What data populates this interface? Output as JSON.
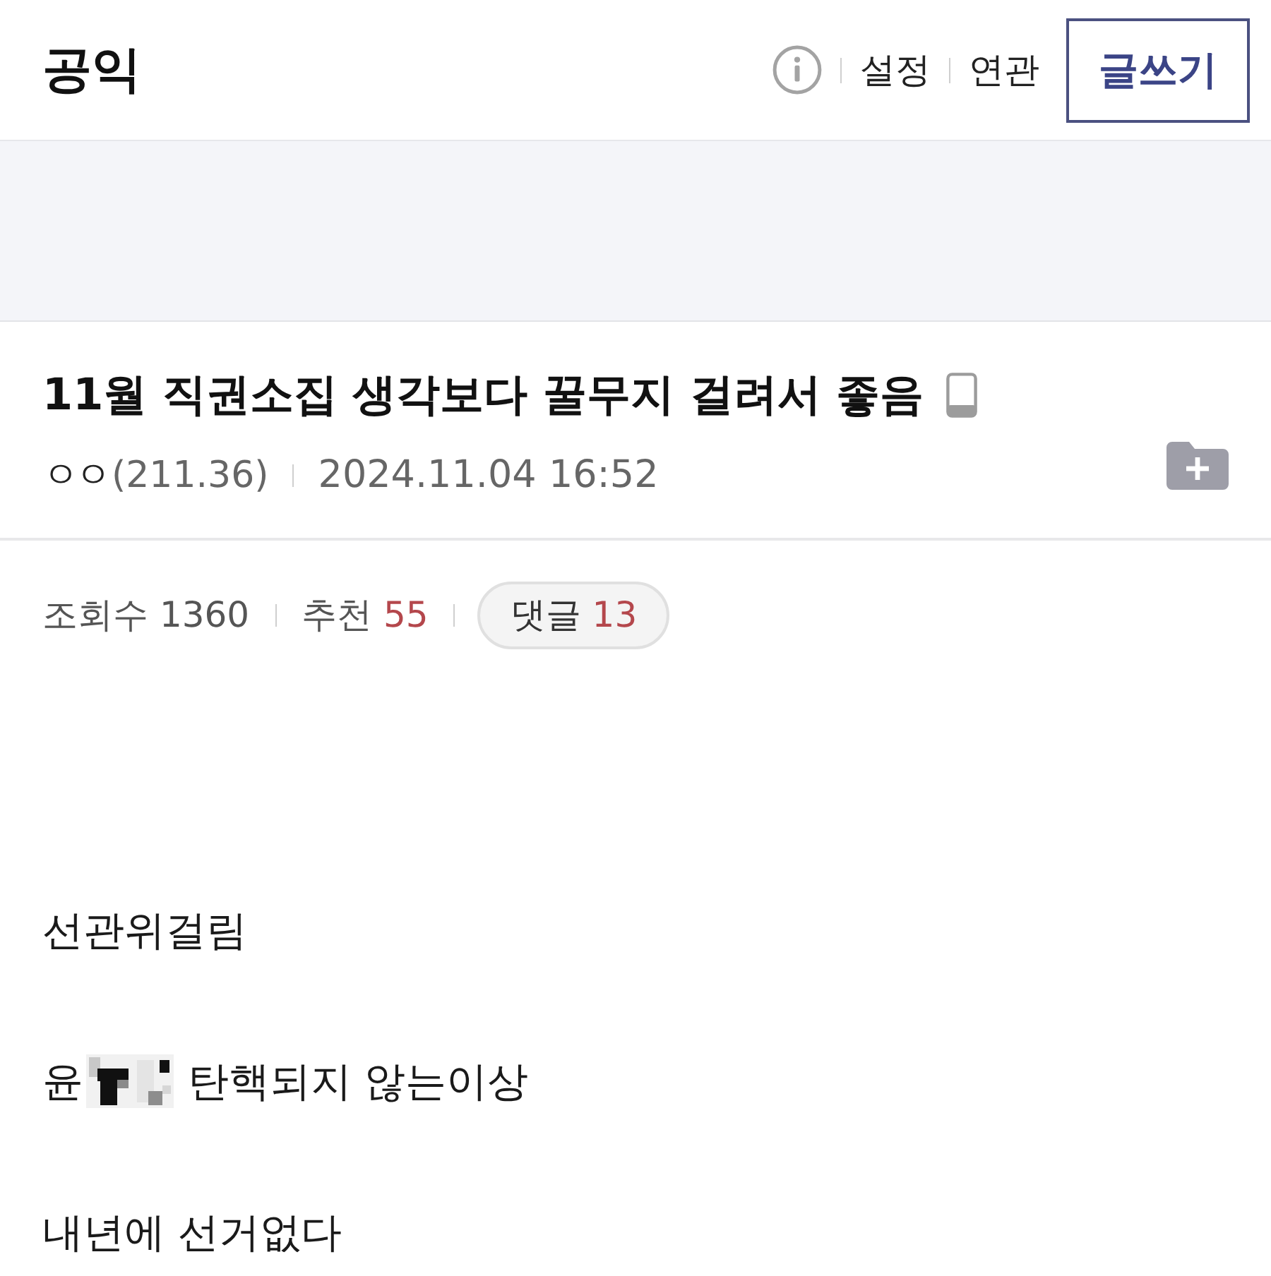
{
  "header": {
    "title": "공익",
    "links": [
      "설정",
      "연관"
    ],
    "write_button": "글쓰기"
  },
  "post": {
    "title": "11월 직권소집 생각보다 꿀무지 걸려서 좋음",
    "author": "ㅇㅇ",
    "ip": "(211.36)",
    "date": "2024.11.04 16:52"
  },
  "stats": [
    {
      "kind": "views",
      "label": "조회수",
      "value": "1360"
    },
    {
      "kind": "votes",
      "label": "추천",
      "value": "55"
    },
    {
      "kind": "comments",
      "label": "댓글",
      "value": "13"
    }
  ],
  "body": {
    "lines": [
      {
        "parts": [
          {
            "kind": "text",
            "text": "선관위걸림"
          }
        ]
      },
      {
        "parts": [
          {
            "kind": "text",
            "text": "윤"
          },
          {
            "kind": "mosaic"
          },
          {
            "kind": "text",
            "text": "탄핵되지 않는이상"
          }
        ]
      },
      {
        "parts": [
          {
            "kind": "text",
            "text": "내년에 선거없다"
          }
        ]
      }
    ]
  }
}
